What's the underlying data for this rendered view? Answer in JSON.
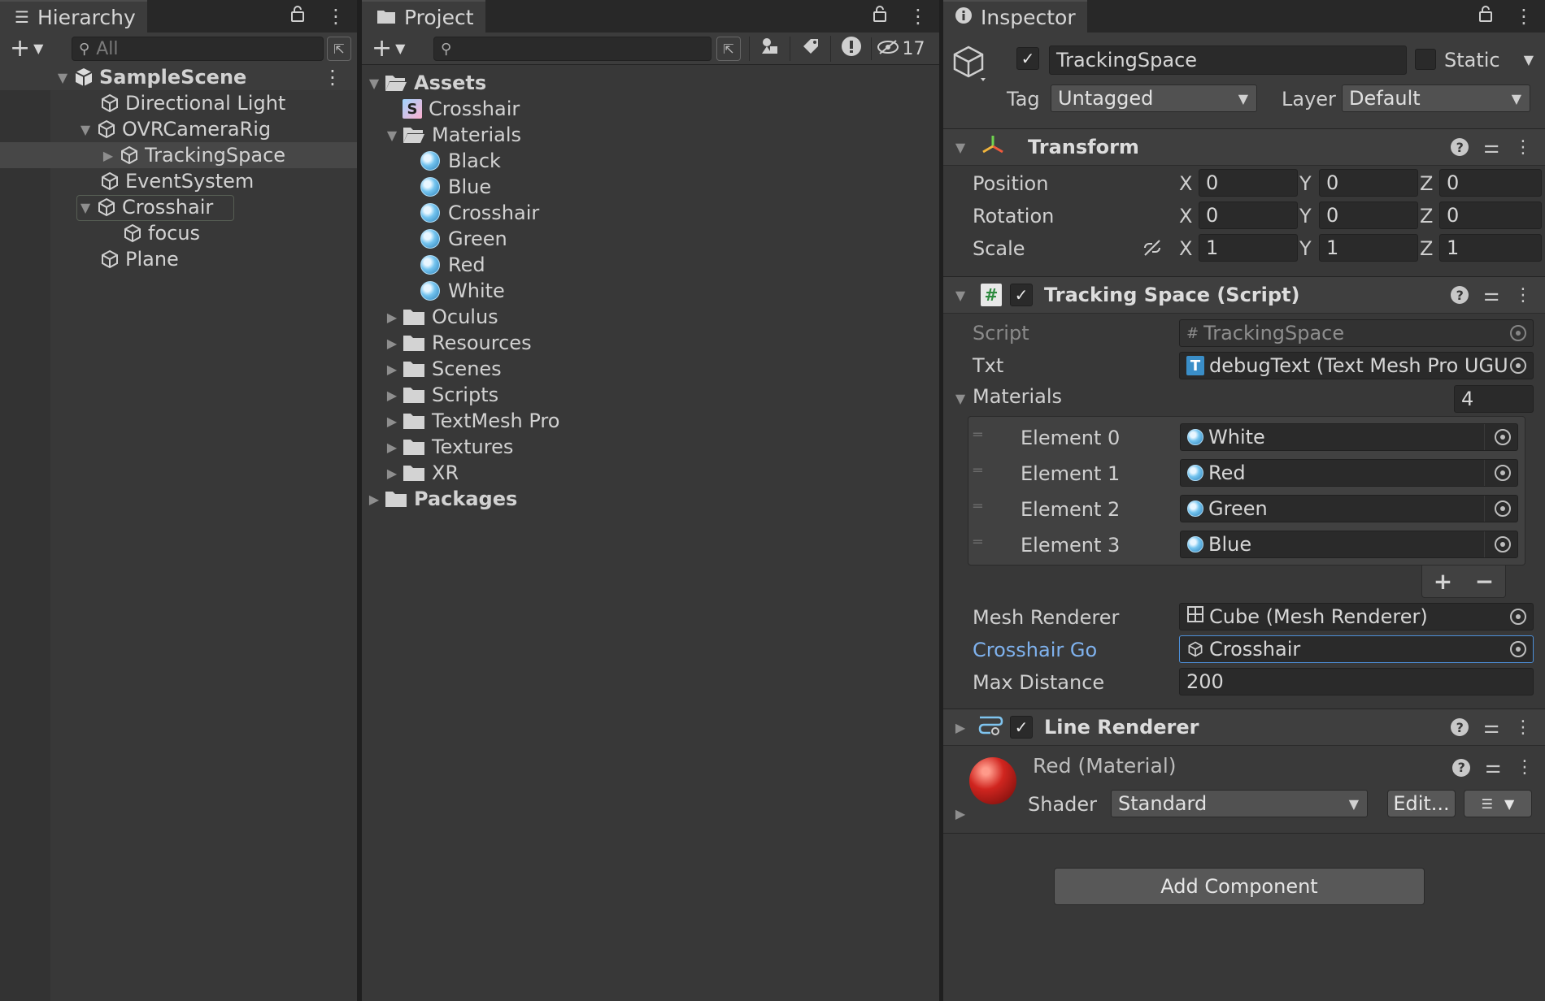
{
  "hierarchy": {
    "tab_label": "Hierarchy",
    "search_placeholder": "All",
    "items": [
      {
        "label": "SampleScene"
      },
      {
        "label": "Directional Light"
      },
      {
        "label": "OVRCameraRig"
      },
      {
        "label": "TrackingSpace"
      },
      {
        "label": "EventSystem"
      },
      {
        "label": "Crosshair"
      },
      {
        "label": "focus"
      },
      {
        "label": "Plane"
      }
    ]
  },
  "project": {
    "tab_label": "Project",
    "hidden_count": "17",
    "tree": [
      {
        "label": "Assets"
      },
      {
        "label": "Crosshair"
      },
      {
        "label": "Materials"
      },
      {
        "label": "Black"
      },
      {
        "label": "Blue"
      },
      {
        "label": "Crosshair"
      },
      {
        "label": "Green"
      },
      {
        "label": "Red"
      },
      {
        "label": "White"
      },
      {
        "label": "Oculus"
      },
      {
        "label": "Resources"
      },
      {
        "label": "Scenes"
      },
      {
        "label": "Scripts"
      },
      {
        "label": "TextMesh Pro"
      },
      {
        "label": "Textures"
      },
      {
        "label": "XR"
      },
      {
        "label": "Packages"
      }
    ]
  },
  "inspector": {
    "tab_label": "Inspector",
    "object_name": "TrackingSpace",
    "static_label": "Static",
    "tag_label": "Tag",
    "tag_value": "Untagged",
    "layer_label": "Layer",
    "layer_value": "Default",
    "transform": {
      "title": "Transform",
      "position_label": "Position",
      "rotation_label": "Rotation",
      "scale_label": "Scale",
      "x": "X",
      "y": "Y",
      "z": "Z",
      "position": [
        "0",
        "0",
        "0"
      ],
      "rotation": [
        "0",
        "0",
        "0"
      ],
      "scale": [
        "1",
        "1",
        "1"
      ]
    },
    "script": {
      "title": "Tracking Space (Script)",
      "script_label": "Script",
      "script_value": "TrackingSpace",
      "txt_label": "Txt",
      "txt_value": "debugText (Text Mesh Pro UGU",
      "materials_label": "Materials",
      "materials_count": "4",
      "elements": [
        {
          "label": "Element 0",
          "value": "White"
        },
        {
          "label": "Element 1",
          "value": "Red"
        },
        {
          "label": "Element 2",
          "value": "Green"
        },
        {
          "label": "Element 3",
          "value": "Blue"
        }
      ],
      "plus": "+",
      "minus": "−",
      "mesh_renderer_label": "Mesh Renderer",
      "mesh_renderer_value": "Cube (Mesh Renderer)",
      "crosshair_go_label": "Crosshair Go",
      "crosshair_go_value": "Crosshair",
      "max_distance_label": "Max Distance",
      "max_distance_value": "200"
    },
    "line_renderer": {
      "title": "Line Renderer"
    },
    "material": {
      "title": "Red (Material)",
      "shader_label": "Shader",
      "shader_value": "Standard",
      "edit_label": "Edit..."
    },
    "add_component_label": "Add Component"
  },
  "colors": {
    "accent_link": "#7fb2ee",
    "selection": "#474747"
  }
}
